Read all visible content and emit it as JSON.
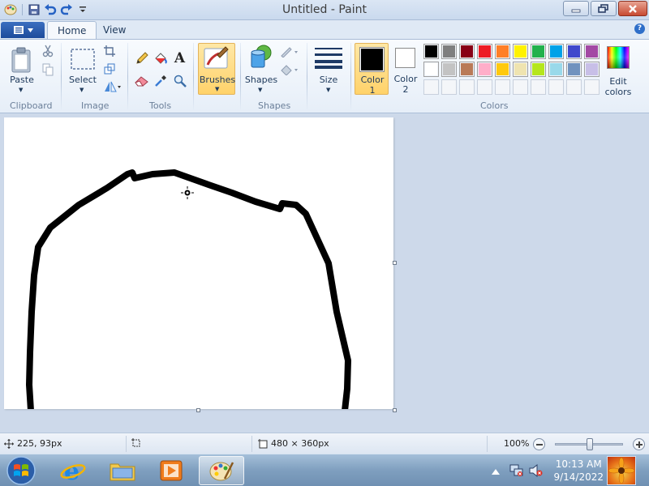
{
  "window": {
    "title": "Untitled - Paint"
  },
  "tabs": [
    {
      "label": "Home"
    },
    {
      "label": "View"
    }
  ],
  "ribbon": {
    "clipboard": {
      "paste": "Paste",
      "group": "Clipboard"
    },
    "image": {
      "select": "Select",
      "group": "Image"
    },
    "tools": {
      "group": "Tools",
      "text_tool": "A"
    },
    "brushes": {
      "label": "Brushes"
    },
    "shapes": {
      "label": "Shapes",
      "group": "Shapes"
    },
    "size": {
      "label": "Size"
    },
    "colors": {
      "color1": "Color",
      "color1_num": "1",
      "color2": "Color",
      "color2_num": "2",
      "edit_colors_line1": "Edit",
      "edit_colors_line2": "colors",
      "group": "Colors",
      "color1_value": "#000000",
      "color2_value": "#ffffff",
      "palette": [
        "#000000",
        "#7f7f7f",
        "#880015",
        "#ed1c24",
        "#ff7f27",
        "#fff200",
        "#22b14c",
        "#00a2e8",
        "#3f48cc",
        "#a349a4",
        "#ffffff",
        "#c3c3c3",
        "#b97a57",
        "#ffaec9",
        "#ffc90e",
        "#efe4b0",
        "#b5e61d",
        "#99d9ea",
        "#7092be",
        "#c8bfe7"
      ]
    },
    "help": "?"
  },
  "statusbar": {
    "cursor_pos": "225, 93px",
    "canvas_size": "480 × 360px",
    "zoom": "100%",
    "zoom_level": 1.0
  },
  "taskbar": {
    "time": "10:13 AM",
    "date": "9/14/2022"
  }
}
